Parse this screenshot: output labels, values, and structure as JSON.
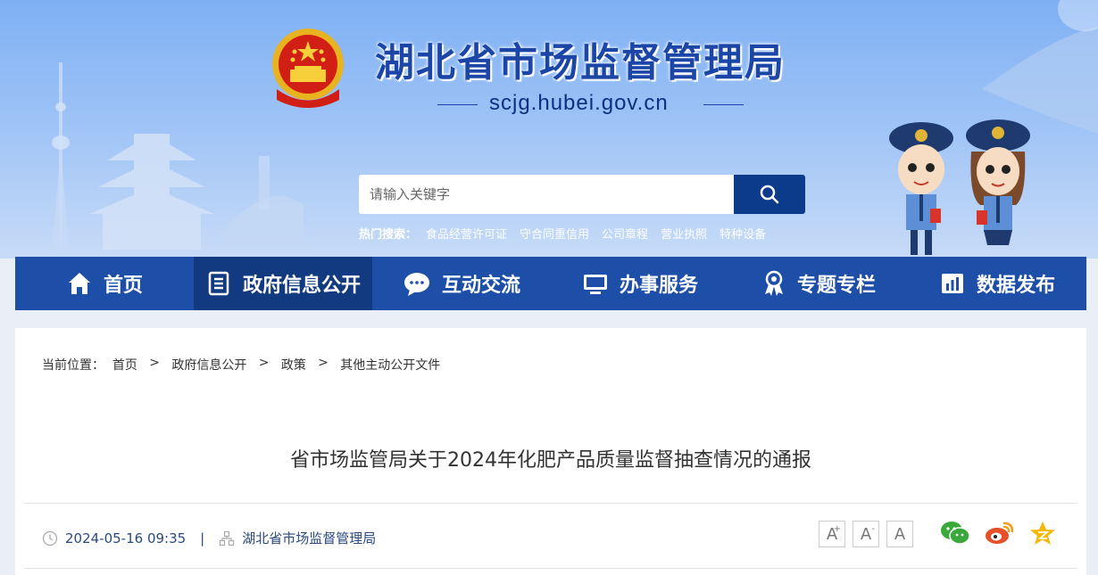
{
  "header": {
    "site_title": "湖北省市场监督管理局",
    "domain": "scjg.hubei.gov.cn",
    "emblem_icon": "national-emblem",
    "search": {
      "placeholder": "请输入关键字",
      "button_icon": "search-icon"
    },
    "hot_search": {
      "label": "热门搜索：",
      "items": [
        "食品经营许可证",
        "守合同重信用",
        "公司章程",
        "营业执照",
        "特种设备"
      ]
    }
  },
  "nav": {
    "items": [
      {
        "label": "首页",
        "icon": "home-icon"
      },
      {
        "label": "政府信息公开",
        "icon": "document-icon"
      },
      {
        "label": "互动交流",
        "icon": "chat-icon"
      },
      {
        "label": "办事服务",
        "icon": "monitor-icon"
      },
      {
        "label": "专题专栏",
        "icon": "award-icon"
      },
      {
        "label": "数据发布",
        "icon": "chart-icon"
      }
    ],
    "active_index": 1
  },
  "breadcrumb": {
    "label": "当前位置：",
    "items": [
      "首页",
      "政府信息公开",
      "政策",
      "其他主动公开文件"
    ],
    "separator": ">"
  },
  "article": {
    "title": "省市场监管局关于2024年化肥产品质量监督抽查情况的通报",
    "date": "2024-05-16 09:35",
    "divider": "|",
    "source": "湖北省市场监督管理局"
  },
  "font_size": {
    "increase": "A",
    "decrease": "A",
    "reset": "A"
  },
  "share": [
    "wechat-icon",
    "weibo-icon",
    "favorite-icon"
  ],
  "colors": {
    "nav_bg": "#1d4fa8",
    "nav_active": "#123a80",
    "title_blue": "#1b46a8",
    "search_btn": "#0d3b8c"
  }
}
